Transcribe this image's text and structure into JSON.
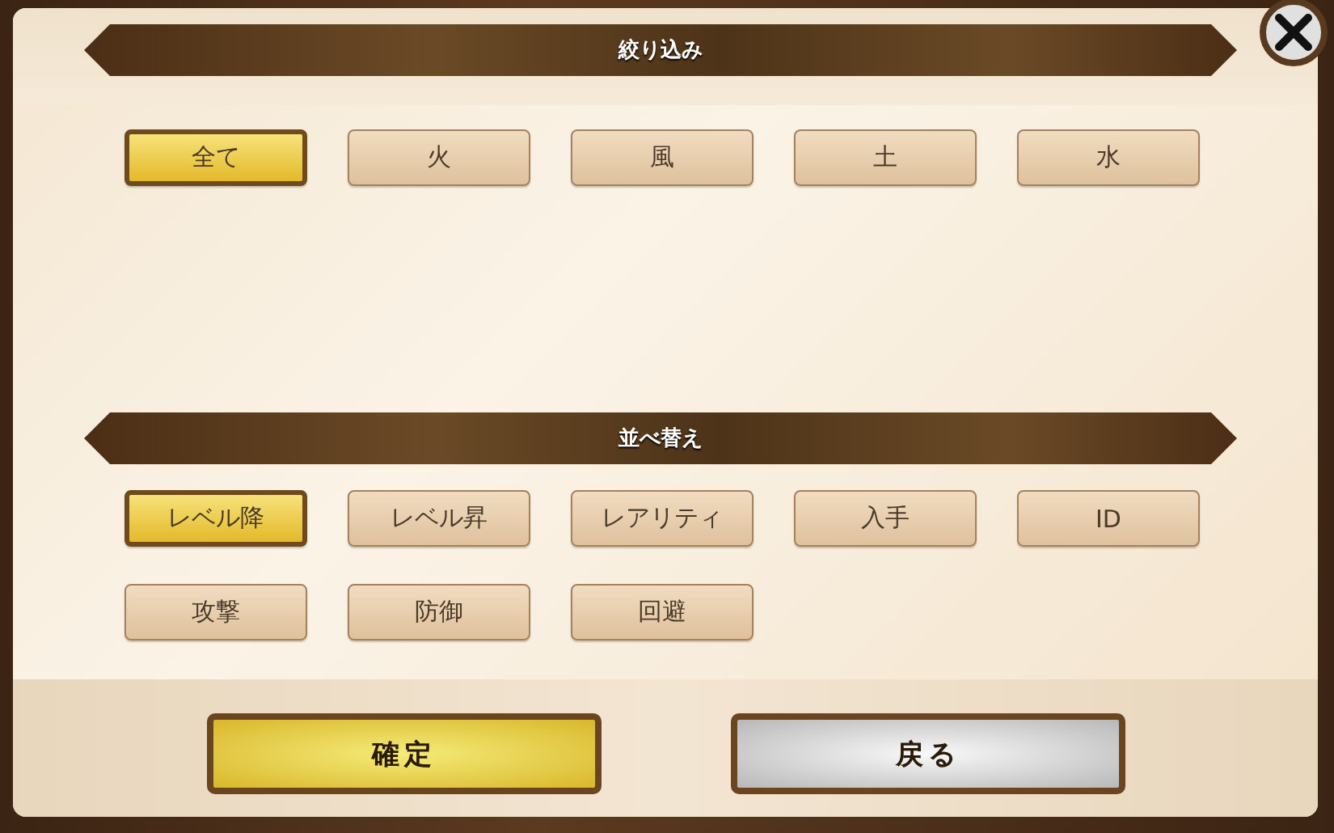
{
  "filter": {
    "title": "絞り込み",
    "options": [
      {
        "label": "全て",
        "selected": true
      },
      {
        "label": "火",
        "selected": false
      },
      {
        "label": "風",
        "selected": false
      },
      {
        "label": "土",
        "selected": false
      },
      {
        "label": "水",
        "selected": false
      }
    ]
  },
  "sort": {
    "title": "並べ替え",
    "options": [
      {
        "label": "レベル降",
        "selected": true
      },
      {
        "label": "レベル昇",
        "selected": false
      },
      {
        "label": "レアリティ",
        "selected": false
      },
      {
        "label": "入手",
        "selected": false
      },
      {
        "label": "ID",
        "selected": false
      },
      {
        "label": "攻撃",
        "selected": false
      },
      {
        "label": "防御",
        "selected": false
      },
      {
        "label": "回避",
        "selected": false
      }
    ]
  },
  "buttons": [
    {
      "label": "確定",
      "kind": "confirm"
    },
    {
      "label": "戻る",
      "kind": "back"
    }
  ]
}
